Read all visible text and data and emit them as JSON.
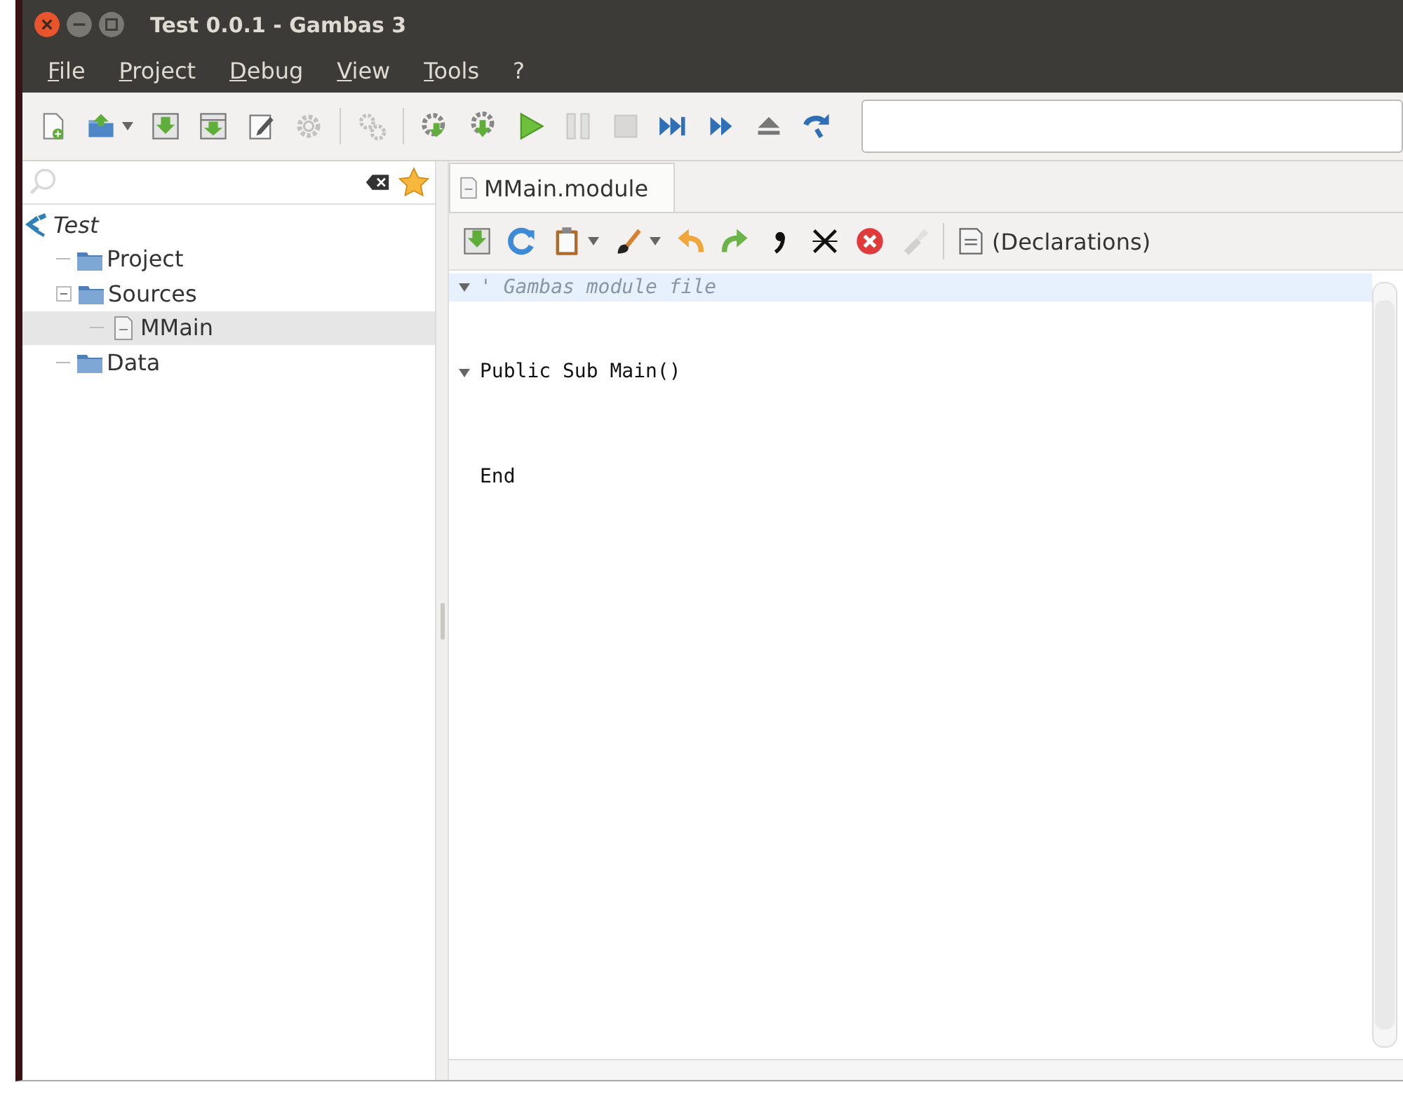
{
  "window": {
    "title": "Test 0.0.1 - Gambas 3"
  },
  "menu": [
    {
      "label": "File"
    },
    {
      "label": "Project"
    },
    {
      "label": "Debug"
    },
    {
      "label": "View"
    },
    {
      "label": "Tools"
    },
    {
      "label": "?"
    }
  ],
  "toolbar": [
    {
      "kind": "button",
      "disabled": false,
      "menu": false
    },
    {
      "kind": "button",
      "disabled": false,
      "menu": true
    },
    {
      "kind": "button",
      "disabled": false,
      "menu": false
    },
    {
      "kind": "button",
      "disabled": false,
      "menu": false
    },
    {
      "kind": "button",
      "disabled": false,
      "menu": false
    },
    {
      "kind": "button",
      "disabled": true,
      "menu": false
    },
    {
      "kind": "separator"
    },
    {
      "kind": "button",
      "disabled": true,
      "menu": false
    },
    {
      "kind": "separator"
    },
    {
      "kind": "button",
      "disabled": false,
      "menu": false
    },
    {
      "kind": "button",
      "disabled": false,
      "menu": false
    },
    {
      "kind": "button",
      "disabled": false,
      "menu": false
    },
    {
      "kind": "button",
      "disabled": true,
      "menu": false
    },
    {
      "kind": "button",
      "disabled": true,
      "menu": false
    },
    {
      "kind": "button",
      "disabled": false,
      "menu": false
    },
    {
      "kind": "button",
      "disabled": false,
      "menu": false
    },
    {
      "kind": "button",
      "disabled": false,
      "menu": false
    },
    {
      "kind": "button",
      "disabled": false,
      "menu": false
    }
  ],
  "project_tree": {
    "label": "Test",
    "expanded": true,
    "children": [
      {
        "label": "Project",
        "selected": false
      },
      {
        "label": "Sources",
        "selected": false,
        "expanded": true,
        "children": [
          {
            "label": "MMain",
            "selected": true
          }
        ]
      },
      {
        "label": "Data",
        "selected": false
      }
    ]
  },
  "tabs": [
    {
      "label": "MMain.module",
      "selected": true
    }
  ],
  "editor_toolbar": {
    "buttons": [
      {
        "disabled": false,
        "menu": false
      },
      {
        "disabled": false,
        "menu": false
      },
      {
        "disabled": false,
        "menu": true
      },
      {
        "disabled": false,
        "menu": true
      },
      {
        "disabled": false,
        "menu": false
      },
      {
        "disabled": false,
        "menu": false
      },
      {
        "disabled": false,
        "menu": false
      },
      {
        "disabled": false,
        "menu": false
      },
      {
        "disabled": false,
        "menu": false
      },
      {
        "disabled": true,
        "menu": false
      }
    ],
    "procedure": "(Declarations)"
  },
  "code_lines": [
    {
      "kind": "comment",
      "text": "' Gambas module file",
      "fold": true,
      "highlighted": true
    },
    {
      "kind": "blank",
      "fold": false,
      "highlighted": false
    },
    {
      "kind": "code",
      "text": "Public Sub Main()",
      "fold": true,
      "highlighted": false
    },
    {
      "kind": "blank",
      "fold": false,
      "highlighted": false
    },
    {
      "kind": "code",
      "text": "End",
      "fold": false,
      "highlighted": false
    }
  ]
}
